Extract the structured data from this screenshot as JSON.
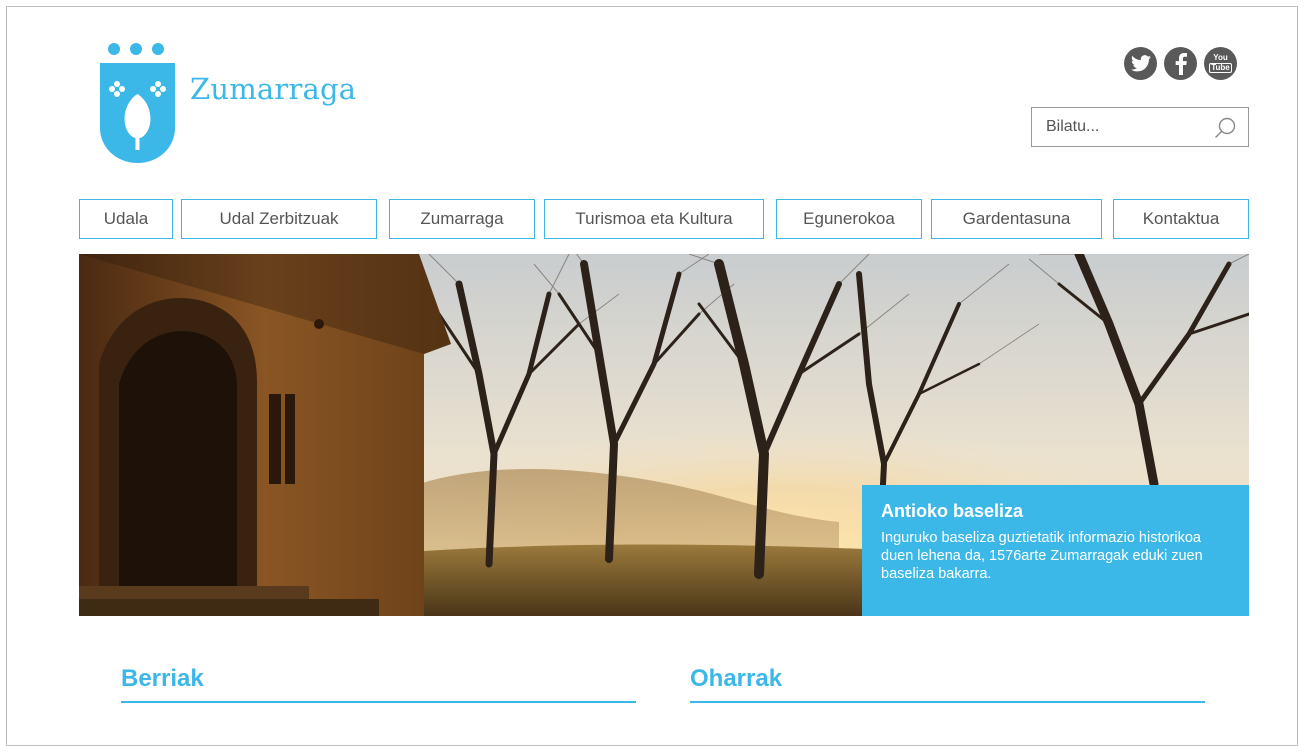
{
  "header": {
    "site_name": "Zumarraga"
  },
  "social": {
    "icons": [
      "twitter-icon",
      "facebook-icon",
      "youtube-icon"
    ],
    "youtube_line1": "You",
    "youtube_line2": "Tube"
  },
  "search": {
    "placeholder": "Bilatu..."
  },
  "nav": {
    "items": [
      {
        "label": "Udala"
      },
      {
        "label": "Udal Zerbitzuak"
      },
      {
        "label": "Zumarraga"
      },
      {
        "label": "Turismoa eta Kultura"
      },
      {
        "label": "Egunerokoa"
      },
      {
        "label": "Gardentasuna"
      },
      {
        "label": "Kontaktua"
      }
    ]
  },
  "hero": {
    "title": "Antioko baseliza",
    "text": "Inguruko baseliza guztietatik informazio historikoa duen lehena da, 1576arte Zumarragak eduki zuen baseliza bakarra."
  },
  "sections": {
    "news_title": "Berriak",
    "notes_title": "Oharrak"
  },
  "colors": {
    "accent": "#3cb8e8",
    "icon_gray": "#595959",
    "border": "#bdbdbd"
  }
}
